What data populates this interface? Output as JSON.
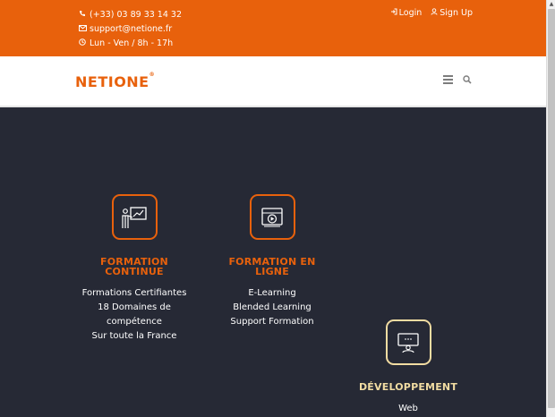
{
  "topbar": {
    "phone": "(+33) 03 89 33 14 32",
    "email": "support@netione.fr",
    "hours": "Lun - Ven / 8h - 17h",
    "login_label": "Login",
    "signup_label": "Sign Up"
  },
  "navbar": {
    "logo_text": "NETIONE",
    "logo_mark": "®"
  },
  "features": [
    {
      "title": "FORMATION CONTINUE",
      "items": [
        "Formations Certifiantes",
        "18 Domaines de",
        "compétence",
        "Sur toute la France"
      ]
    },
    {
      "title": "FORMATION EN LIGNE",
      "items": [
        "E-Learning",
        "Blended Learning",
        "Support Formation"
      ]
    },
    {
      "title": "DÉVELOPPEMENT",
      "items": [
        "Web"
      ]
    }
  ],
  "colors": {
    "accent": "#e8610c",
    "dark_bg": "#262935",
    "light_accent": "#f1dca2"
  }
}
